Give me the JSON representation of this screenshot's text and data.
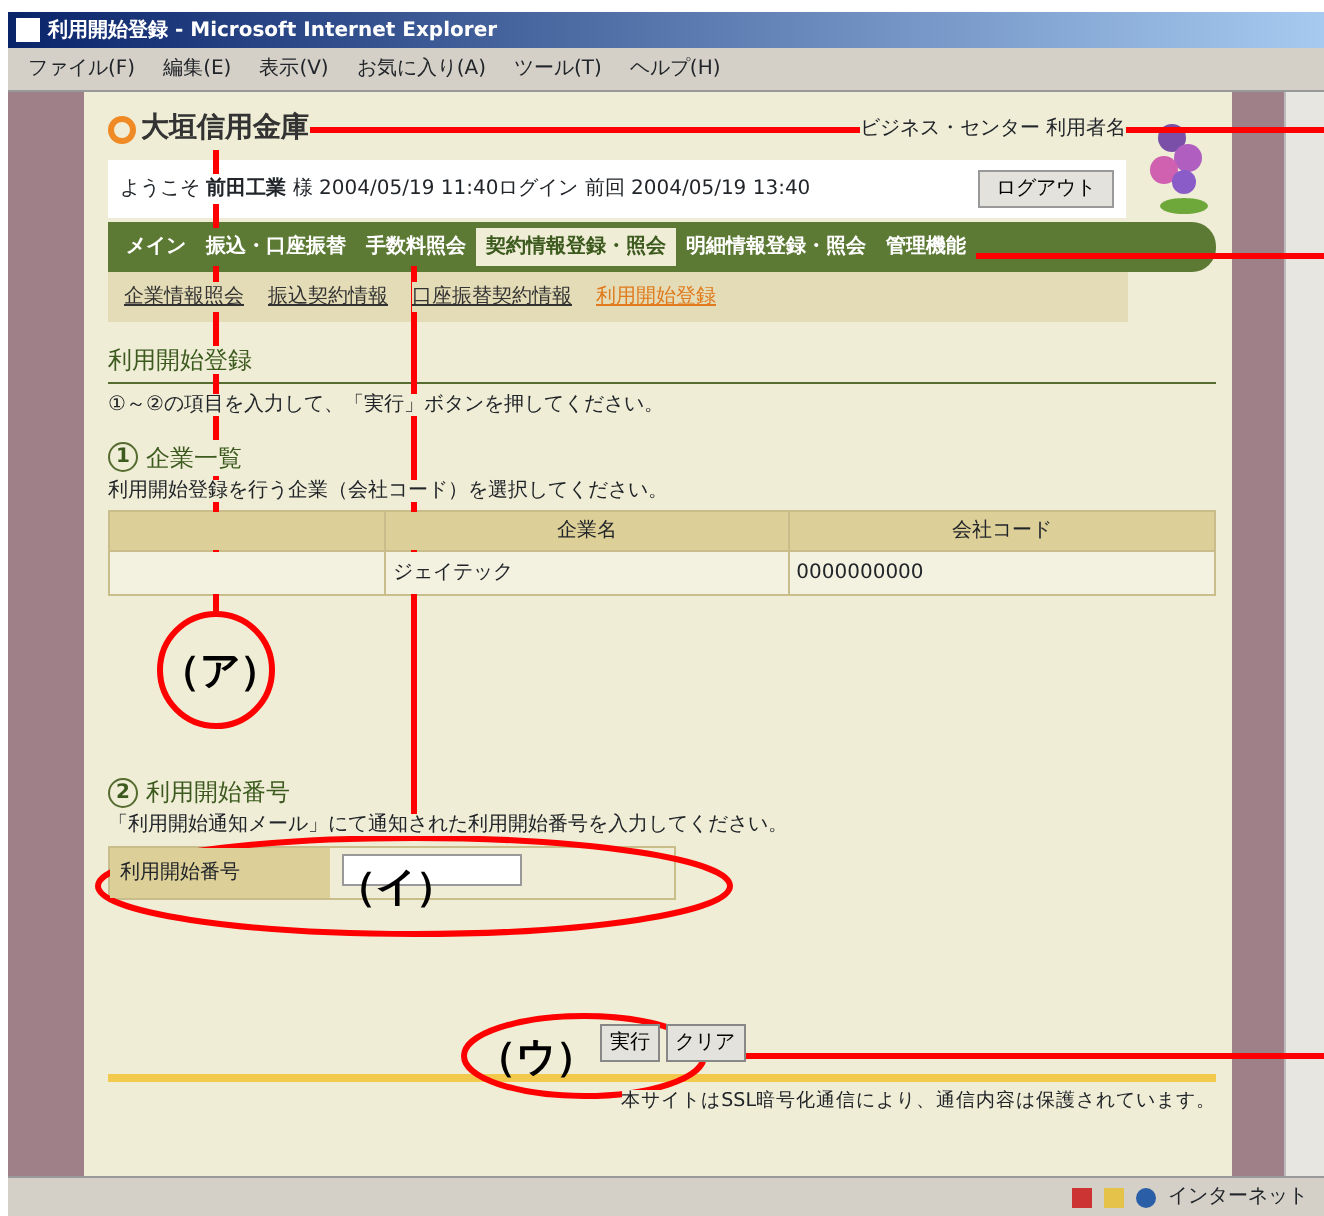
{
  "window": {
    "title": "利用開始登録 - Microsoft Internet Explorer"
  },
  "menu": [
    "ファイル(F)",
    "編集(E)",
    "表示(V)",
    "お気に入り(A)",
    "ツール(T)",
    "ヘルプ(H)"
  ],
  "header": {
    "bank": "大垣信用金庫",
    "service": "ビジネス・センター 利用者名"
  },
  "welcome": {
    "text": "ようこそ **前田工業** 様 2004/05/19 11:40ログイン 前回 2004/05/19 13:40",
    "logout": "ログアウト"
  },
  "tabs": [
    {
      "label": "メイン",
      "selected": false
    },
    {
      "label": "振込・口座振替",
      "selected": false
    },
    {
      "label": "手数料照会",
      "selected": false
    },
    {
      "label": "契約情報登録・照会",
      "selected": true
    },
    {
      "label": "明細情報登録・照会",
      "selected": false
    },
    {
      "label": "管理機能",
      "selected": false
    }
  ],
  "subnav": [
    {
      "label": "企業情報照会",
      "selected": false
    },
    {
      "label": "振込契約情報",
      "selected": false
    },
    {
      "label": "口座振替契約情報",
      "selected": false
    },
    {
      "label": "利用開始登録",
      "selected": true
    }
  ],
  "page_title": "利用開始登録",
  "instruction": "①～②の項目を入力して、「実行」ボタンを押してください。",
  "section1": {
    "number": "1",
    "title": "企業一覧",
    "note": "利用開始登録を行う企業（会社コード）を選択してください。",
    "columns": [
      "企業名",
      "会社コード"
    ],
    "rows": [
      [
        "ジェイテック",
        "0000000000"
      ]
    ]
  },
  "section2": {
    "number": "2",
    "title": "利用開始番号",
    "note": "「利用開始通知メール」にて通知された利用開始番号を入力してください。",
    "field_label": "利用開始番号"
  },
  "buttons": [
    "実行",
    "クリア"
  ],
  "footer": "本サイトはSSL暗号化通信により、通信内容は保護されています。",
  "status_bar": {
    "zone": "インターネット"
  },
  "annotations": [
    {
      "label": "（ア）"
    },
    {
      "label": "（イ）"
    },
    {
      "label": "（ウ）"
    }
  ]
}
